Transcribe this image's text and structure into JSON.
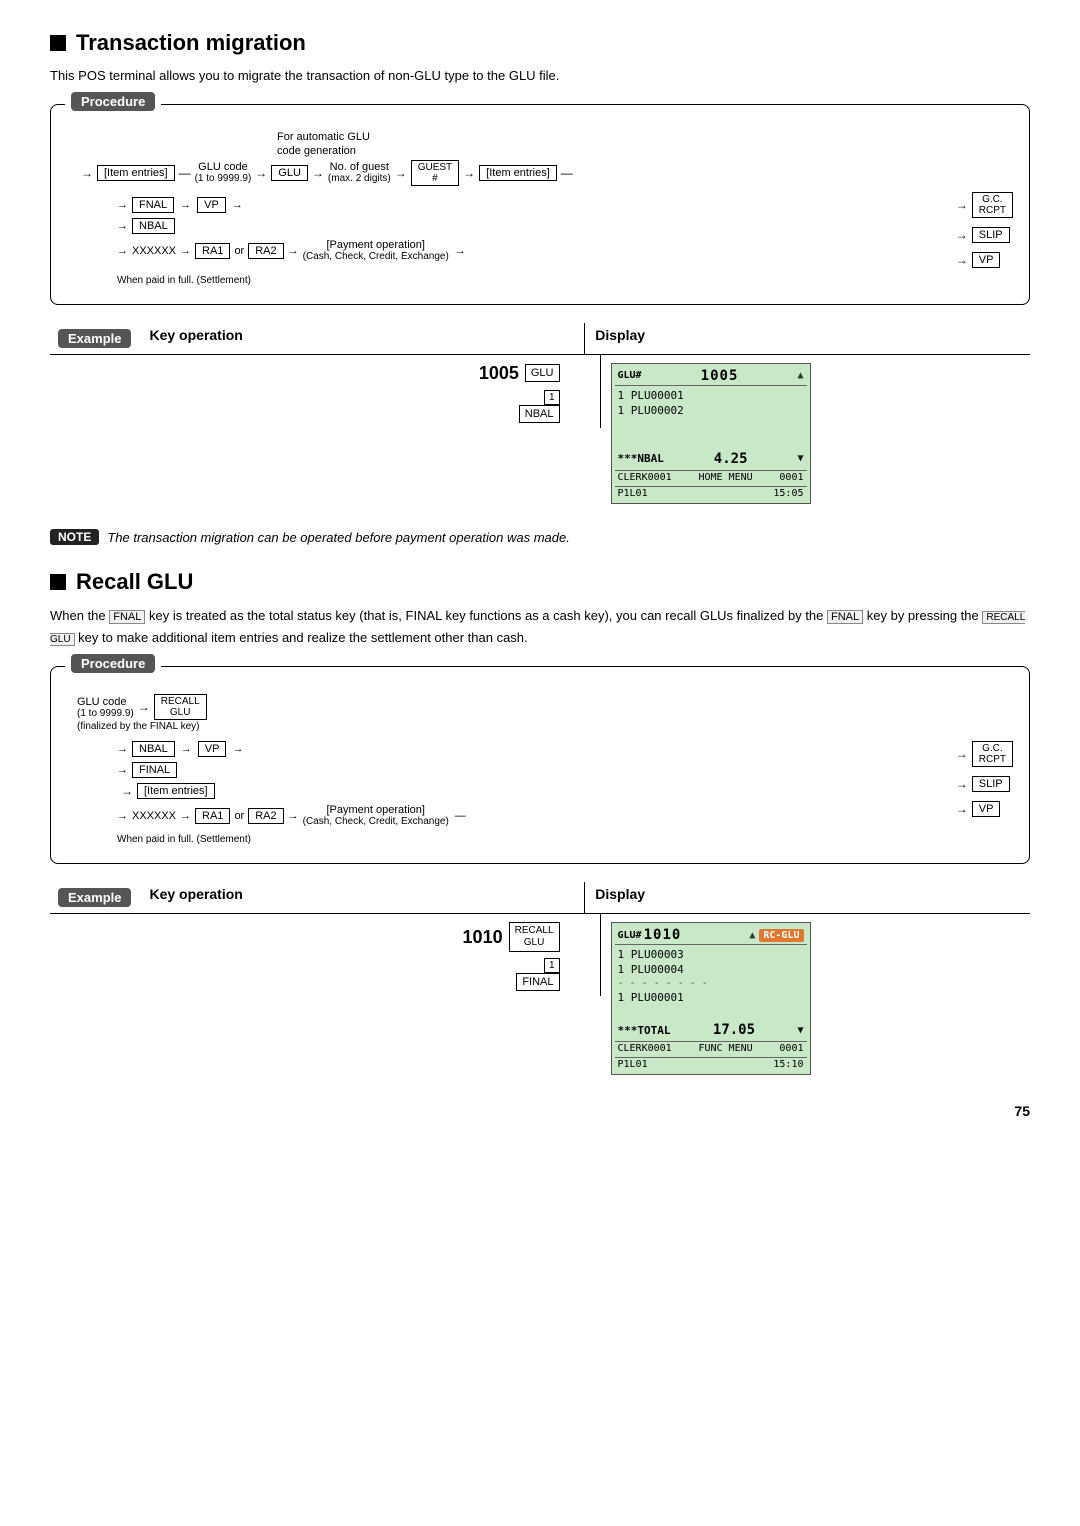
{
  "page": {
    "sections": [
      {
        "id": "transaction-migration",
        "title": "Transaction migration",
        "description": "This POS terminal allows you to migrate the transaction of non-GLU type to the GLU file.",
        "procedure": {
          "label": "Procedure",
          "flow": {
            "auto_glu_label": "For automatic GLU\ncode generation",
            "item_entries": "[Item entries]",
            "glu_code_label": "GLU code",
            "glu_code_range": "(1 to 9999.9)",
            "glu_key": "GLU",
            "no_of_guest": "No. of guest",
            "max_digits": "(max. 2 digits)",
            "guest_key": "GUEST\n#",
            "item_entries2": "[Item entries]",
            "fnal_key": "FNAL",
            "nbal_key": "NBAL",
            "vp_key": "VP",
            "xxxxxx": "XXXXXX",
            "ra1_key": "RA1",
            "or_text": "or",
            "ra2_key": "RA2",
            "payment_op": "[Payment operation]",
            "cash_etc": "(Cash, Check, Credit, Exchange)",
            "when_paid": "When paid in full. (Settlement)",
            "gc_rcpt_key": "G.C.\nRCPT",
            "slip_key": "SLIP",
            "vp_key2": "VP"
          }
        },
        "example": {
          "label": "Example",
          "key_op_header": "Key operation",
          "display_header": "Display",
          "key_sequence": [
            {
              "value": "1005",
              "key": "GLU"
            },
            {
              "value": "1",
              "key": null
            },
            {
              "value": null,
              "key": "NBAL"
            }
          ],
          "number_1005": "1005",
          "number_1": "1",
          "display": {
            "header": "GLU#1005",
            "triangle": "▲",
            "rows": [
              "1  PLU00001",
              "1  PLU00002"
            ],
            "blank_rows": 2,
            "total_label": "***NBAL",
            "total_value": "4.25",
            "total_tri": "▼",
            "footer_clerk": "CLERK0001",
            "footer_menu": "HOME MENU",
            "footer_num": "0001",
            "footer_p": "P1L01",
            "footer_time": "15:05"
          }
        },
        "note": {
          "label": "NOTE",
          "text": "The transaction migration can be operated before payment operation was made."
        }
      },
      {
        "id": "recall-glu",
        "title": "Recall GLU",
        "description_parts": [
          "When the ",
          "FNAL",
          " key is treated as the total status key (that is, FINAL key functions as a cash key), you can recall GLUs finalized by the ",
          "FNAL",
          " key by pressing the ",
          "RECALL\nGLU",
          " key to make additional item entries and realize the settlement other than cash."
        ],
        "description": "When the FNAL key is treated as the total status key (that is, FINAL key functions as a cash key), you can recall GLUs finalized by the FNAL key by pressing the RECALL GLU key to make additional item entries and realize the settlement other than cash.",
        "procedure": {
          "label": "Procedure",
          "flow": {
            "glu_code_label": "GLU code",
            "glu_code_range": "(1 to 9999.9)",
            "finalized": "(finalized by the FINAL key)",
            "recall_glu_key": "RECALL\nGLU",
            "nbal_key": "NBAL",
            "vp_key": "VP",
            "fnal_key": "FINAL",
            "item_entries": "[Item entries]",
            "xxxxxx": "XXXXXX",
            "ra1_key": "RA1",
            "or_text": "or",
            "ra2_key": "RA2",
            "payment_op": "[Payment operation]",
            "cash_etc": "(Cash, Check, Credit, Exchange)",
            "when_paid": "When paid in full. (Settlement)",
            "gc_rcpt_key": "G.C.\nRCPT",
            "slip_key": "SLIP",
            "vp_key2": "VP"
          }
        },
        "example": {
          "label": "Example",
          "key_op_header": "Key operation",
          "display_header": "Display",
          "number_1010": "1010",
          "recall_glu_key": "RECALL\nGLU",
          "number_1": "1",
          "final_key": "FINAL",
          "display": {
            "header": "GLU#1010",
            "triangle": "▲",
            "rc_glu_badge": "RC-GLU",
            "rows": [
              "1  PLU00003",
              "1  PLU00004"
            ],
            "separator": "- - - - - - - -",
            "rows2": [
              "1  PLU00001"
            ],
            "blank_rows": 1,
            "total_label": "***TOTAL",
            "total_value": "17.05",
            "total_tri": "▼",
            "footer_clerk": "CLERK0001",
            "footer_menu": "FUNC MENU",
            "footer_num": "0001",
            "footer_p": "P1L01",
            "footer_time": "15:10"
          }
        }
      }
    ],
    "page_number": "75"
  }
}
